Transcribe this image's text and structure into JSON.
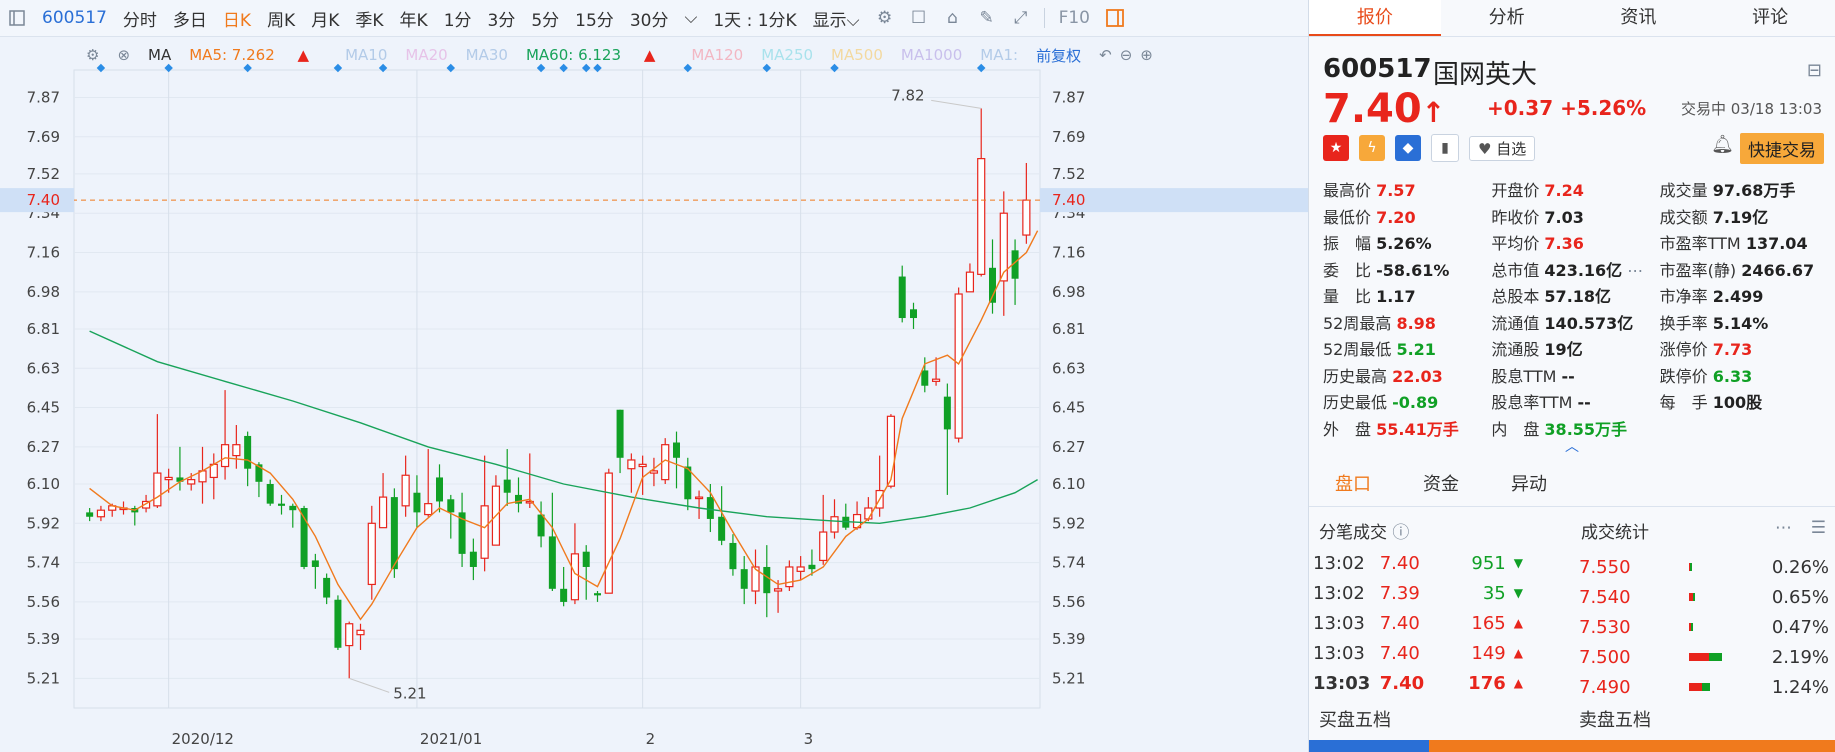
{
  "toolbar": {
    "code": "600517",
    "items": [
      "分时",
      "多日",
      "日K",
      "周K",
      "月K",
      "季K",
      "年K",
      "1分",
      "3分",
      "5分",
      "15分",
      "30分"
    ],
    "active": "日K",
    "period_select": "1天 : 1分K",
    "display": "显示",
    "f10": "F10"
  },
  "ma": {
    "label": "MA",
    "ma5": "MA5: 7.262",
    "ma10": "MA10",
    "ma20": "MA20",
    "ma30": "MA30",
    "ma60": "MA60: 6.123",
    "ma120": "MA120",
    "ma250": "MA250",
    "ma500": "MA500",
    "ma1000": "MA1000",
    "ma1": "MA1:",
    "fuquan": "前复权",
    "colors": {
      "ma5": "#f07a1d",
      "ma60": "#19a35a"
    }
  },
  "chart_data": {
    "type": "candlestick",
    "y_ticks": [
      "7.87",
      "7.69",
      "7.52",
      "7.34",
      "7.16",
      "6.98",
      "6.81",
      "6.63",
      "6.45",
      "6.27",
      "6.10",
      "5.92",
      "5.74",
      "5.56",
      "5.39",
      "5.21"
    ],
    "ylim": [
      5.12,
      7.95
    ],
    "x_labels": [
      "2020/12",
      "2021/01",
      "2",
      "3"
    ],
    "x_label_index": [
      7,
      29,
      49,
      63
    ],
    "current_price": "7.40",
    "high_label": "7.82",
    "low_label": "5.21",
    "candles": [
      [
        5.97,
        5.95,
        5.99,
        5.93
      ],
      [
        5.95,
        5.98,
        6.0,
        5.93
      ],
      [
        5.98,
        6.0,
        6.01,
        5.95
      ],
      [
        5.99,
        5.99,
        6.02,
        5.96
      ],
      [
        5.99,
        5.97,
        6.0,
        5.91
      ],
      [
        5.99,
        6.02,
        6.05,
        5.97
      ],
      [
        6.0,
        6.15,
        6.42,
        5.99
      ],
      [
        6.12,
        6.13,
        6.17,
        6.06
      ],
      [
        6.13,
        6.11,
        6.27,
        6.07
      ],
      [
        6.1,
        6.12,
        6.15,
        6.07
      ],
      [
        6.11,
        6.16,
        6.27,
        6.01
      ],
      [
        6.13,
        6.19,
        6.24,
        6.03
      ],
      [
        6.18,
        6.28,
        6.53,
        6.12
      ],
      [
        6.23,
        6.28,
        6.37,
        6.17
      ],
      [
        6.32,
        6.17,
        6.34,
        6.09
      ],
      [
        6.19,
        6.11,
        6.2,
        6.04
      ],
      [
        6.1,
        6.01,
        6.12,
        6.0
      ],
      [
        6.01,
        6.0,
        6.05,
        5.96
      ],
      [
        6.0,
        5.98,
        6.01,
        5.9
      ],
      [
        5.99,
        5.72,
        6.0,
        5.71
      ],
      [
        5.75,
        5.72,
        5.78,
        5.62
      ],
      [
        5.67,
        5.58,
        5.69,
        5.55
      ],
      [
        5.57,
        5.35,
        5.59,
        5.34
      ],
      [
        5.36,
        5.46,
        5.47,
        5.21
      ],
      [
        5.41,
        5.43,
        5.46,
        5.34
      ],
      [
        5.64,
        5.92,
        6.0,
        5.57
      ],
      [
        5.9,
        6.04,
        6.15,
        5.9
      ],
      [
        6.04,
        5.71,
        6.08,
        5.67
      ],
      [
        6.0,
        6.14,
        6.23,
        5.95
      ],
      [
        6.06,
        5.97,
        6.14,
        5.9
      ],
      [
        5.96,
        6.01,
        6.26,
        5.95
      ],
      [
        6.13,
        6.02,
        6.19,
        5.97
      ],
      [
        6.03,
        5.97,
        6.05,
        5.85
      ],
      [
        5.97,
        5.78,
        6.06,
        5.72
      ],
      [
        5.79,
        5.72,
        5.85,
        5.66
      ],
      [
        5.76,
        6.0,
        6.23,
        5.7
      ],
      [
        5.82,
        6.09,
        6.14,
        5.82
      ],
      [
        6.12,
        6.06,
        6.26,
        6.0
      ],
      [
        6.05,
        6.01,
        6.13,
        5.97
      ],
      [
        6.02,
        6.02,
        6.24,
        5.99
      ],
      [
        5.96,
        5.86,
        6.02,
        5.81
      ],
      [
        5.86,
        5.62,
        6.06,
        5.61
      ],
      [
        5.62,
        5.56,
        5.72,
        5.54
      ],
      [
        5.57,
        5.78,
        5.92,
        5.55
      ],
      [
        5.79,
        5.72,
        5.82,
        5.57
      ],
      [
        5.6,
        5.59,
        5.61,
        5.56
      ],
      [
        5.6,
        6.15,
        6.17,
        5.6
      ],
      [
        6.44,
        6.22,
        6.44,
        6.15
      ],
      [
        6.17,
        6.21,
        6.24,
        6.06
      ],
      [
        6.18,
        6.19,
        6.23,
        6.05
      ],
      [
        6.15,
        6.16,
        6.22,
        6.09
      ],
      [
        6.12,
        6.28,
        6.31,
        6.1
      ],
      [
        6.29,
        6.22,
        6.34,
        6.08
      ],
      [
        6.18,
        6.03,
        6.22,
        5.98
      ],
      [
        6.04,
        6.04,
        6.07,
        5.94
      ],
      [
        6.04,
        5.94,
        6.1,
        5.88
      ],
      [
        5.95,
        5.84,
        6.09,
        5.82
      ],
      [
        5.83,
        5.71,
        5.87,
        5.68
      ],
      [
        5.71,
        5.62,
        5.77,
        5.55
      ],
      [
        5.61,
        5.72,
        5.8,
        5.55
      ],
      [
        5.72,
        5.6,
        5.82,
        5.49
      ],
      [
        5.61,
        5.62,
        5.66,
        5.51
      ],
      [
        5.63,
        5.72,
        5.75,
        5.61
      ],
      [
        5.7,
        5.72,
        5.77,
        5.66
      ],
      [
        5.73,
        5.71,
        5.8,
        5.68
      ],
      [
        5.75,
        5.88,
        6.05,
        5.73
      ],
      [
        5.88,
        5.95,
        6.03,
        5.85
      ],
      [
        5.95,
        5.9,
        6.01,
        5.89
      ],
      [
        5.9,
        5.96,
        6.02,
        5.89
      ],
      [
        5.94,
        5.99,
        6.04,
        5.93
      ],
      [
        5.99,
        6.07,
        6.23,
        5.95
      ],
      [
        6.09,
        6.41,
        6.42,
        6.08
      ],
      [
        7.05,
        6.86,
        7.1,
        6.84
      ],
      [
        6.9,
        6.86,
        6.93,
        6.81
      ],
      [
        6.62,
        6.55,
        6.68,
        6.52
      ],
      [
        6.57,
        6.58,
        6.68,
        6.55
      ],
      [
        6.5,
        6.35,
        6.56,
        6.05
      ],
      [
        6.31,
        6.97,
        7.0,
        6.29
      ],
      [
        6.98,
        7.07,
        7.11,
        7.02
      ],
      [
        7.06,
        7.59,
        7.82,
        7.05
      ],
      [
        7.09,
        6.93,
        7.22,
        6.88
      ],
      [
        7.03,
        7.34,
        7.44,
        6.87
      ],
      [
        7.17,
        7.04,
        7.22,
        6.92
      ],
      [
        7.24,
        7.4,
        7.57,
        7.2
      ]
    ],
    "ma5_points": [
      [
        0,
        6.08
      ],
      [
        2,
        6.0
      ],
      [
        4,
        5.98
      ],
      [
        6,
        6.04
      ],
      [
        8,
        6.11
      ],
      [
        10,
        6.16
      ],
      [
        12,
        6.22
      ],
      [
        14,
        6.21
      ],
      [
        16,
        6.15
      ],
      [
        18,
        6.03
      ],
      [
        20,
        5.86
      ],
      [
        22,
        5.64
      ],
      [
        24,
        5.48
      ],
      [
        25,
        5.55
      ],
      [
        27,
        5.73
      ],
      [
        29,
        5.9
      ],
      [
        31,
        5.99
      ],
      [
        33,
        5.94
      ],
      [
        35,
        5.9
      ],
      [
        37,
        6.01
      ],
      [
        39,
        6.03
      ],
      [
        41,
        5.9
      ],
      [
        43,
        5.69
      ],
      [
        45,
        5.63
      ],
      [
        47,
        5.85
      ],
      [
        49,
        6.13
      ],
      [
        51,
        6.21
      ],
      [
        53,
        6.17
      ],
      [
        55,
        6.06
      ],
      [
        57,
        5.88
      ],
      [
        59,
        5.71
      ],
      [
        61,
        5.64
      ],
      [
        63,
        5.66
      ],
      [
        65,
        5.72
      ],
      [
        67,
        5.86
      ],
      [
        69,
        5.94
      ],
      [
        71,
        6.12
      ],
      [
        72,
        6.4
      ],
      [
        74,
        6.65
      ],
      [
        76,
        6.69
      ],
      [
        77,
        6.65
      ],
      [
        79,
        6.85
      ],
      [
        81,
        7.07
      ],
      [
        83,
        7.16
      ],
      [
        84,
        7.26
      ]
    ],
    "ma60_points": [
      [
        0,
        6.8
      ],
      [
        6,
        6.66
      ],
      [
        12,
        6.57
      ],
      [
        18,
        6.48
      ],
      [
        24,
        6.38
      ],
      [
        30,
        6.27
      ],
      [
        36,
        6.19
      ],
      [
        42,
        6.1
      ],
      [
        48,
        6.04
      ],
      [
        54,
        5.99
      ],
      [
        60,
        5.95
      ],
      [
        66,
        5.93
      ],
      [
        70,
        5.92
      ],
      [
        74,
        5.95
      ],
      [
        78,
        5.99
      ],
      [
        82,
        6.06
      ],
      [
        84,
        6.12
      ]
    ]
  },
  "quote": {
    "tabs": [
      "报价",
      "分析",
      "资讯",
      "评论"
    ],
    "active_tab": "报价",
    "code": "600517",
    "name": "国网英大",
    "price": "7.40",
    "change": "+0.37 +5.26%",
    "status": "交易中 03/18 13:03",
    "fav": "自选",
    "fast_trade": "快捷交易",
    "rows": [
      [
        [
          "最高价",
          "7.57",
          "red"
        ],
        [
          "开盘价",
          "7.24",
          "red"
        ],
        [
          "成交量",
          "97.68万手",
          "dark"
        ]
      ],
      [
        [
          "最低价",
          "7.20",
          "red"
        ],
        [
          "昨收价",
          "7.03",
          "dark"
        ],
        [
          "成交额",
          "7.19亿",
          "dark"
        ]
      ],
      [
        [
          "振　幅",
          "5.26%",
          "dark"
        ],
        [
          "平均价",
          "7.36",
          "red"
        ],
        [
          "市盈率TTM",
          "137.04",
          "dark"
        ]
      ],
      [
        [
          "委　比",
          "-58.61%",
          "dark"
        ],
        [
          "总市值",
          "423.16亿",
          "dark"
        ],
        [
          "市盈率(静)",
          "2466.67",
          "dark"
        ]
      ],
      [
        [
          "量　比",
          "1.17",
          "dark"
        ],
        [
          "总股本",
          "57.18亿",
          "dark"
        ],
        [
          "市净率",
          "2.499",
          "dark"
        ]
      ],
      [
        [
          "52周最高",
          "8.98",
          "red"
        ],
        [
          "流通值",
          "140.573亿",
          "dark"
        ],
        [
          "换手率",
          "5.14%",
          "dark"
        ]
      ],
      [
        [
          "52周最低",
          "5.21",
          "green"
        ],
        [
          "流通股",
          "19亿",
          "dark"
        ],
        [
          "涨停价",
          "7.73",
          "red"
        ]
      ],
      [
        [
          "历史最高",
          "22.03",
          "red"
        ],
        [
          "股息TTM",
          "--",
          "dark"
        ],
        [
          "跌停价",
          "6.33",
          "green"
        ]
      ],
      [
        [
          "历史最低",
          "-0.89",
          "green"
        ],
        [
          "股息率TTM",
          "--",
          "dark"
        ],
        [
          "每　手",
          "100股",
          "dark"
        ]
      ],
      [
        [
          "外　盘",
          "55.41万手",
          "red"
        ],
        [
          "内　盘",
          "38.55万手",
          "green"
        ],
        [
          "",
          "",
          " "
        ]
      ]
    ]
  },
  "subtabs": [
    "盘口",
    "资金",
    "异动"
  ],
  "active_subtab": "盘口",
  "ticks_title": "分笔成交",
  "stats_title": "成交统计",
  "ticks": [
    [
      "13:02",
      "7.40",
      "951",
      "down"
    ],
    [
      "13:02",
      "7.39",
      "35",
      "down"
    ],
    [
      "13:03",
      "7.40",
      "165",
      "up"
    ],
    [
      "13:03",
      "7.40",
      "149",
      "up"
    ],
    [
      "13:03",
      "7.40",
      "176",
      "up"
    ]
  ],
  "stats": [
    [
      "7.550",
      "0.26%",
      0.04
    ],
    [
      "7.540",
      "0.65%",
      0.1
    ],
    [
      "7.530",
      "0.47%",
      0.07
    ],
    [
      "7.500",
      "2.19%",
      0.55
    ],
    [
      "7.490",
      "1.24%",
      0.35
    ]
  ],
  "book": {
    "buy": "买盘五档",
    "sell": "卖盘五档"
  }
}
